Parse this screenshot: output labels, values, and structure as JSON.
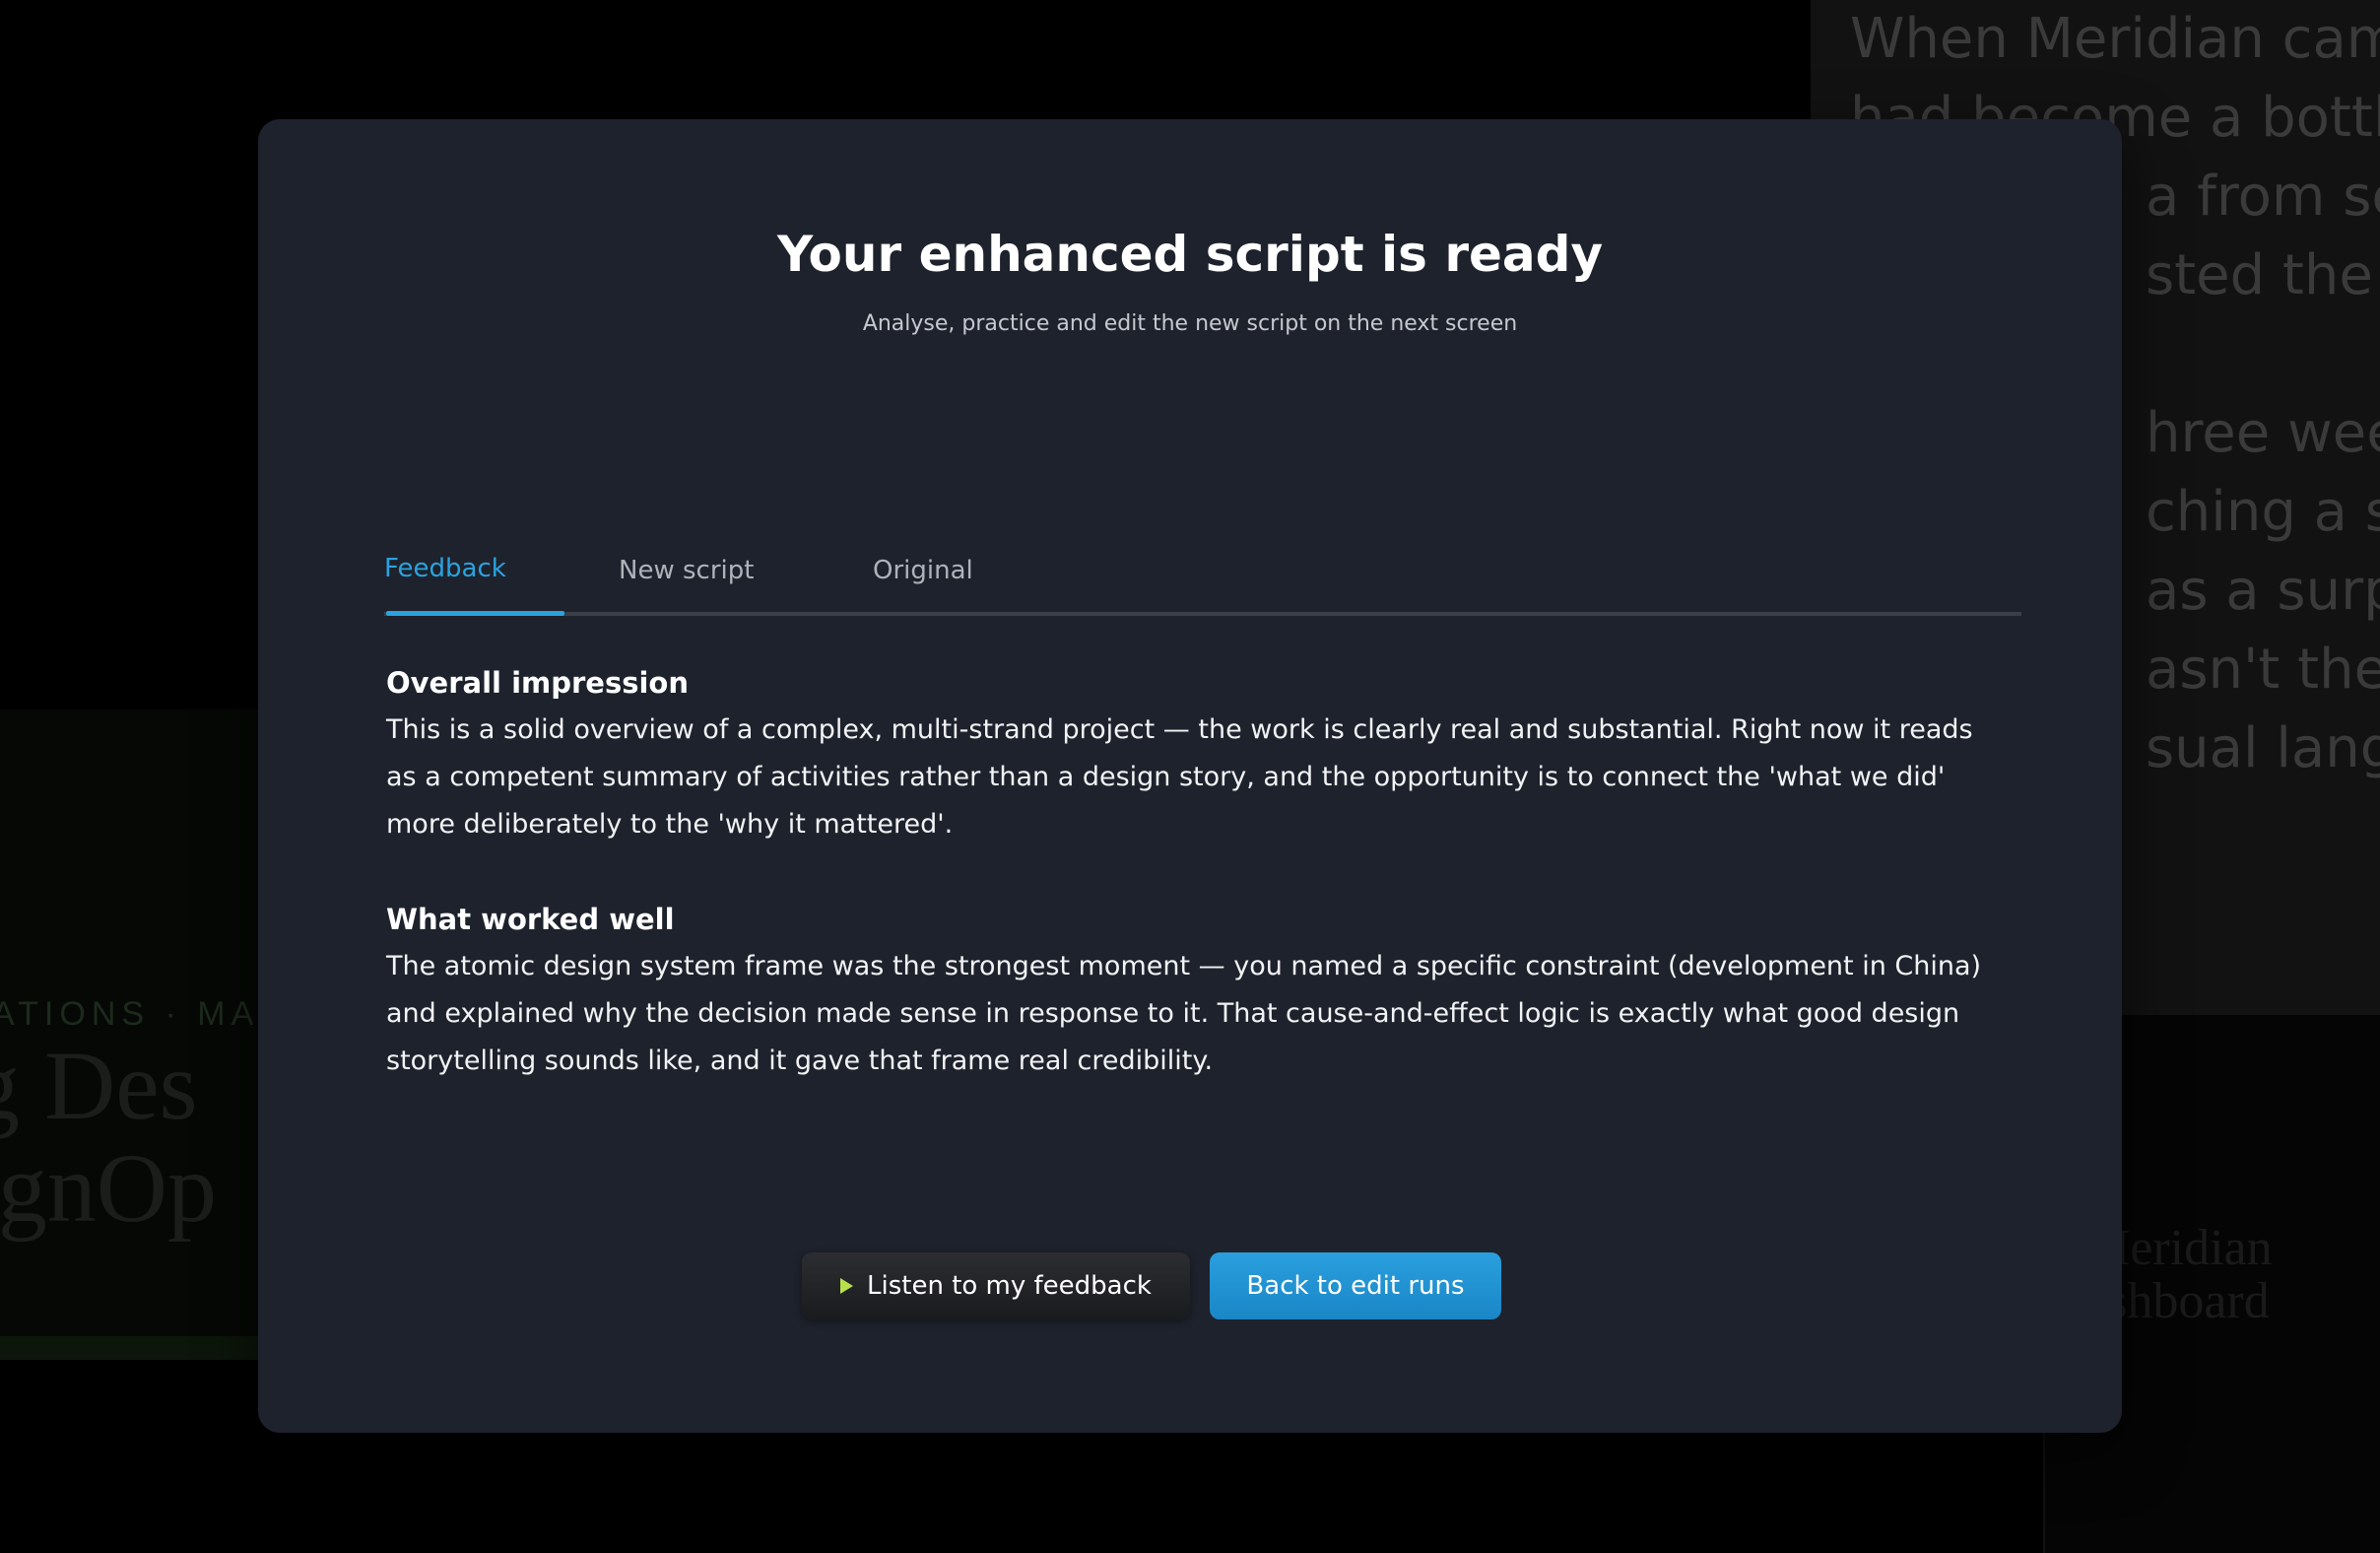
{
  "background": {
    "right_panel_lines": [
      "When Meridian came",
      "had become a bottlen",
      "a from seve",
      "sted the nu",
      "",
      "hree weeks",
      "ching a sing",
      "as a surpri",
      "asn't the da",
      "sual langua"
    ],
    "left_card": {
      "eyebrow": "ATIONS · MA",
      "title_lines": [
        "g Des",
        "ignOp"
      ]
    },
    "right_card": {
      "title_lines": [
        "Meridian",
        "ashboard"
      ]
    }
  },
  "modal": {
    "title": "Your enhanced script is ready",
    "subtitle": "Analyse, practice and edit the new script on the next screen",
    "tabs": [
      {
        "label": "Feedback",
        "active": true
      },
      {
        "label": "New script",
        "active": false
      },
      {
        "label": "Original",
        "active": false
      }
    ],
    "sections": [
      {
        "heading": "Overall impression",
        "body": "This is a solid overview of a complex, multi-strand project — the work is clearly real and substantial. Right now it reads as a competent summary of activities rather than a design story, and the opportunity is to connect the 'what we did' more deliberately to the 'why it mattered'."
      },
      {
        "heading": "What worked well",
        "body": "The atomic design system frame was the strongest moment — you named a specific constraint (development in China) and explained why the decision made sense in response to it. That cause-and-effect logic is exactly what good design storytelling sounds like, and it gave that frame real credibility."
      }
    ],
    "buttons": {
      "listen_label": "Listen to my feedback",
      "back_label": "Back to edit runs"
    }
  },
  "colors": {
    "accent": "#2aa3e0",
    "modal_bg": "#1e222c",
    "play_icon": "#b8e04a"
  }
}
